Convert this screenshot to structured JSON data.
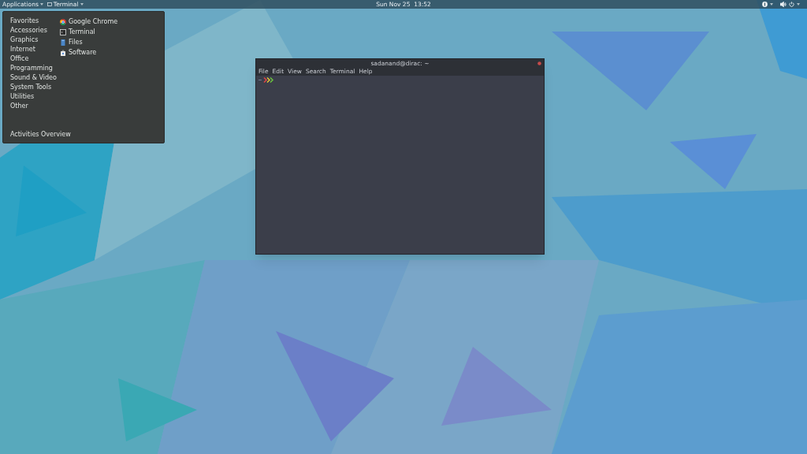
{
  "top_bar": {
    "applications": "Applications",
    "current_app": "Terminal",
    "clock": "Sun Nov 25  13:52"
  },
  "app_menu": {
    "categories": [
      {
        "label": "Favorites"
      },
      {
        "label": "Accessories"
      },
      {
        "label": "Graphics"
      },
      {
        "label": "Internet"
      },
      {
        "label": "Office"
      },
      {
        "label": "Programming"
      },
      {
        "label": "Sound & Video"
      },
      {
        "label": "System Tools"
      },
      {
        "label": "Utilities"
      },
      {
        "label": "Other"
      }
    ],
    "apps": [
      {
        "label": "Google Chrome",
        "kind": "chrome"
      },
      {
        "label": "Terminal",
        "kind": "terminal"
      },
      {
        "label": "Files",
        "kind": "files"
      },
      {
        "label": "Software",
        "kind": "software"
      }
    ],
    "footer": "Activities Overview"
  },
  "terminal": {
    "title": "sadanand@dirac: ~",
    "menu": [
      "File",
      "Edit",
      "View",
      "Search",
      "Terminal",
      "Help"
    ]
  }
}
